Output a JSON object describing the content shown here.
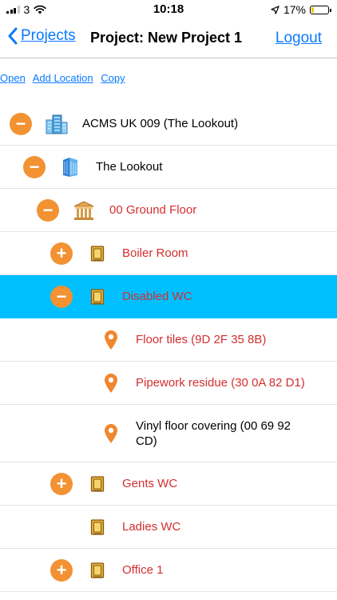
{
  "status": {
    "carrier": "3",
    "time": "10:18",
    "battery": "17%",
    "battery_level": 0.17
  },
  "nav": {
    "back_label": "Projects",
    "title": "Project: New Project 1",
    "logout_label": "Logout"
  },
  "toolbar": {
    "open": "Open",
    "add_location": "Add Location",
    "copy": "Copy"
  },
  "tree": [
    {
      "label": "ACMS UK 009 (The Lookout)",
      "toggle": "−",
      "icon": "office-building-icon",
      "color": "#000000",
      "level": 0
    },
    {
      "label": "The Lookout",
      "toggle": "−",
      "icon": "building-icon",
      "color": "#000000",
      "level": 1
    },
    {
      "label": "00 Ground Floor",
      "toggle": "−",
      "icon": "floor-icon",
      "color": "#d32f2f",
      "level": 2
    },
    {
      "label": "Boiler Room",
      "toggle": "+",
      "icon": "room-icon",
      "color": "#d32f2f",
      "level": 3
    },
    {
      "label": "Disabled WC",
      "toggle": "−",
      "icon": "room-icon",
      "color": "#d32f2f",
      "level": 3,
      "selected": true
    },
    {
      "label": "Floor tiles (9D 2F 35 8B)",
      "icon": "location-pin-icon",
      "color": "#d32f2f",
      "level": 4
    },
    {
      "label": "Pipework residue (30 0A 82 D1)",
      "icon": "location-pin-icon",
      "color": "#d32f2f",
      "level": 4
    },
    {
      "label": "Vinyl floor covering (00 69 92 CD)",
      "icon": "location-pin-icon",
      "color": "#000000",
      "level": 4
    },
    {
      "label": "Gents WC",
      "toggle": "+",
      "icon": "room-icon",
      "color": "#d32f2f",
      "level": 3
    },
    {
      "label": "Ladies WC",
      "icon": "room-icon",
      "color": "#d32f2f",
      "level": 3
    },
    {
      "label": "Office 1",
      "toggle": "+",
      "icon": "room-icon",
      "color": "#d32f2f",
      "level": 3
    }
  ]
}
